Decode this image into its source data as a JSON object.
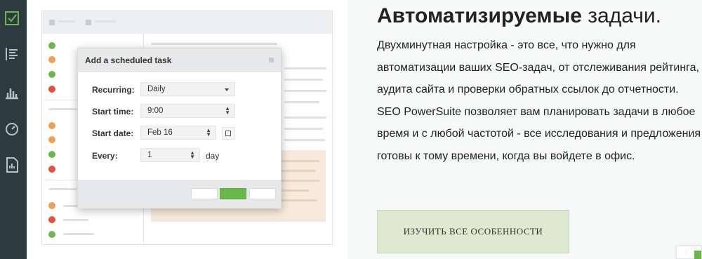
{
  "sidebar": {
    "icons": [
      "checkbox-icon",
      "list-icon",
      "bar-chart-icon",
      "gauge-icon",
      "report-icon"
    ],
    "accent": "#6ab84a"
  },
  "dialog": {
    "title": "Add a scheduled task",
    "fields": {
      "recurring": {
        "label": "Recurring:",
        "value": "Daily"
      },
      "start_time": {
        "label": "Start time:",
        "value": "9:00"
      },
      "start_date": {
        "label": "Start date:",
        "value": "Feb 16"
      },
      "every": {
        "label": "Every:",
        "value": "1",
        "unit": "day"
      }
    }
  },
  "status_colors": {
    "green": "#6ab84a",
    "orange": "#f0a050",
    "red": "#e8503c"
  },
  "content": {
    "headline_bold": "Автоматизируемые",
    "headline_rest": " задачи.",
    "paragraph": "Двухминутная настройка - это все, что нужно для автоматизации ваших SEO-задач, от отслеживания рейтинга, аудита сайта и проверки обратных ссылок до отчетности. SEO PowerSuite позволяет вам планировать задачи в любое время и с любой частотой - все исследования и предложения готовы к тому времени, когда вы войдете в офис.",
    "cta": "ИЗУЧИТЬ ВСЕ ОСОБЕННОСТИ"
  }
}
